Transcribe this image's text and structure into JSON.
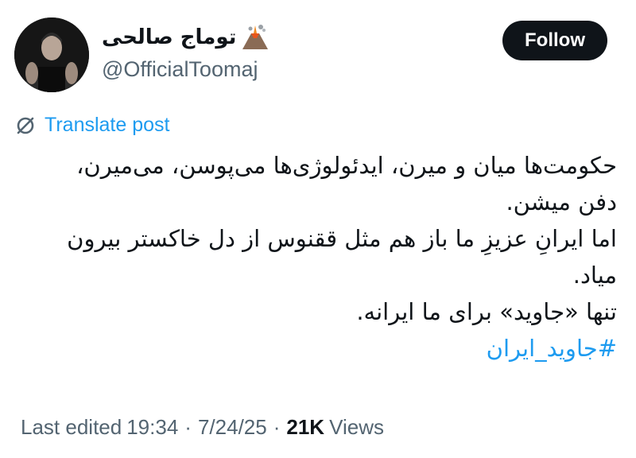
{
  "author": {
    "display_name": "توماج صالحی",
    "handle": "@OfficialToomaj",
    "name_emoji_icon": "volcano-icon"
  },
  "actions": {
    "follow_label": "Follow",
    "translate_label": "Translate post"
  },
  "tweet": {
    "lines": [
      "حکومت‌ها میان و میرن، ایدئولوژی‌ها می‌پوسن، می‌میرن،",
      "دفن میشن.",
      "اما ایرانِ عزیزِ ما باز هم مثل ققنوس از دل خاکستر بیرون",
      "میاد.",
      "تنها «جاوید» برای ما ایرانه."
    ],
    "hashtag": "#جاوید_ایران"
  },
  "meta": {
    "edited_label": "Last edited",
    "time": "19:34",
    "date": "7/24/25",
    "separator": "·",
    "views_count": "21K",
    "views_label": "Views"
  },
  "colors": {
    "accent": "#1d9bf0",
    "text_primary": "#0f1419",
    "text_secondary": "#536471",
    "button_bg": "#0f1419"
  }
}
